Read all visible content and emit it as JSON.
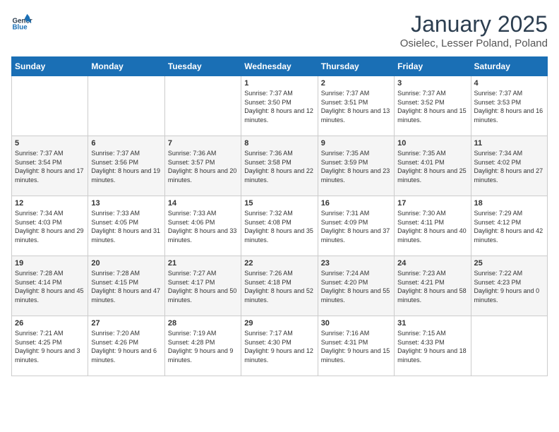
{
  "logo": {
    "text_general": "General",
    "text_blue": "Blue"
  },
  "header": {
    "month": "January 2025",
    "location": "Osielec, Lesser Poland, Poland"
  },
  "columns": [
    "Sunday",
    "Monday",
    "Tuesday",
    "Wednesday",
    "Thursday",
    "Friday",
    "Saturday"
  ],
  "weeks": [
    [
      {
        "day": "",
        "info": ""
      },
      {
        "day": "",
        "info": ""
      },
      {
        "day": "",
        "info": ""
      },
      {
        "day": "1",
        "info": "Sunrise: 7:37 AM\nSunset: 3:50 PM\nDaylight: 8 hours and 12 minutes."
      },
      {
        "day": "2",
        "info": "Sunrise: 7:37 AM\nSunset: 3:51 PM\nDaylight: 8 hours and 13 minutes."
      },
      {
        "day": "3",
        "info": "Sunrise: 7:37 AM\nSunset: 3:52 PM\nDaylight: 8 hours and 15 minutes."
      },
      {
        "day": "4",
        "info": "Sunrise: 7:37 AM\nSunset: 3:53 PM\nDaylight: 8 hours and 16 minutes."
      }
    ],
    [
      {
        "day": "5",
        "info": "Sunrise: 7:37 AM\nSunset: 3:54 PM\nDaylight: 8 hours and 17 minutes."
      },
      {
        "day": "6",
        "info": "Sunrise: 7:37 AM\nSunset: 3:56 PM\nDaylight: 8 hours and 19 minutes."
      },
      {
        "day": "7",
        "info": "Sunrise: 7:36 AM\nSunset: 3:57 PM\nDaylight: 8 hours and 20 minutes."
      },
      {
        "day": "8",
        "info": "Sunrise: 7:36 AM\nSunset: 3:58 PM\nDaylight: 8 hours and 22 minutes."
      },
      {
        "day": "9",
        "info": "Sunrise: 7:35 AM\nSunset: 3:59 PM\nDaylight: 8 hours and 23 minutes."
      },
      {
        "day": "10",
        "info": "Sunrise: 7:35 AM\nSunset: 4:01 PM\nDaylight: 8 hours and 25 minutes."
      },
      {
        "day": "11",
        "info": "Sunrise: 7:34 AM\nSunset: 4:02 PM\nDaylight: 8 hours and 27 minutes."
      }
    ],
    [
      {
        "day": "12",
        "info": "Sunrise: 7:34 AM\nSunset: 4:03 PM\nDaylight: 8 hours and 29 minutes."
      },
      {
        "day": "13",
        "info": "Sunrise: 7:33 AM\nSunset: 4:05 PM\nDaylight: 8 hours and 31 minutes."
      },
      {
        "day": "14",
        "info": "Sunrise: 7:33 AM\nSunset: 4:06 PM\nDaylight: 8 hours and 33 minutes."
      },
      {
        "day": "15",
        "info": "Sunrise: 7:32 AM\nSunset: 4:08 PM\nDaylight: 8 hours and 35 minutes."
      },
      {
        "day": "16",
        "info": "Sunrise: 7:31 AM\nSunset: 4:09 PM\nDaylight: 8 hours and 37 minutes."
      },
      {
        "day": "17",
        "info": "Sunrise: 7:30 AM\nSunset: 4:11 PM\nDaylight: 8 hours and 40 minutes."
      },
      {
        "day": "18",
        "info": "Sunrise: 7:29 AM\nSunset: 4:12 PM\nDaylight: 8 hours and 42 minutes."
      }
    ],
    [
      {
        "day": "19",
        "info": "Sunrise: 7:28 AM\nSunset: 4:14 PM\nDaylight: 8 hours and 45 minutes."
      },
      {
        "day": "20",
        "info": "Sunrise: 7:28 AM\nSunset: 4:15 PM\nDaylight: 8 hours and 47 minutes."
      },
      {
        "day": "21",
        "info": "Sunrise: 7:27 AM\nSunset: 4:17 PM\nDaylight: 8 hours and 50 minutes."
      },
      {
        "day": "22",
        "info": "Sunrise: 7:26 AM\nSunset: 4:18 PM\nDaylight: 8 hours and 52 minutes."
      },
      {
        "day": "23",
        "info": "Sunrise: 7:24 AM\nSunset: 4:20 PM\nDaylight: 8 hours and 55 minutes."
      },
      {
        "day": "24",
        "info": "Sunrise: 7:23 AM\nSunset: 4:21 PM\nDaylight: 8 hours and 58 minutes."
      },
      {
        "day": "25",
        "info": "Sunrise: 7:22 AM\nSunset: 4:23 PM\nDaylight: 9 hours and 0 minutes."
      }
    ],
    [
      {
        "day": "26",
        "info": "Sunrise: 7:21 AM\nSunset: 4:25 PM\nDaylight: 9 hours and 3 minutes."
      },
      {
        "day": "27",
        "info": "Sunrise: 7:20 AM\nSunset: 4:26 PM\nDaylight: 9 hours and 6 minutes."
      },
      {
        "day": "28",
        "info": "Sunrise: 7:19 AM\nSunset: 4:28 PM\nDaylight: 9 hours and 9 minutes."
      },
      {
        "day": "29",
        "info": "Sunrise: 7:17 AM\nSunset: 4:30 PM\nDaylight: 9 hours and 12 minutes."
      },
      {
        "day": "30",
        "info": "Sunrise: 7:16 AM\nSunset: 4:31 PM\nDaylight: 9 hours and 15 minutes."
      },
      {
        "day": "31",
        "info": "Sunrise: 7:15 AM\nSunset: 4:33 PM\nDaylight: 9 hours and 18 minutes."
      },
      {
        "day": "",
        "info": ""
      }
    ]
  ]
}
